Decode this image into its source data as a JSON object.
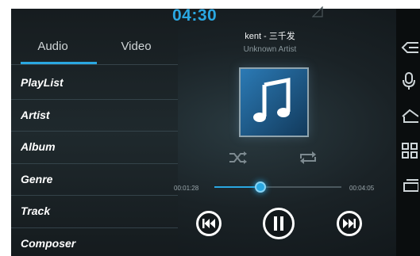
{
  "status": {
    "clock": "04:30"
  },
  "tabs": [
    {
      "label": "Audio",
      "active": true
    },
    {
      "label": "Video",
      "active": false
    }
  ],
  "menu": [
    {
      "label": "PlayList"
    },
    {
      "label": "Artist"
    },
    {
      "label": "Album"
    },
    {
      "label": "Genre"
    },
    {
      "label": "Track"
    },
    {
      "label": "Composer"
    }
  ],
  "now_playing": {
    "title": "kent - 三千发",
    "artist": "Unknown Artist",
    "elapsed": "00:01:28",
    "total": "00:04:05",
    "progress": 0.36
  },
  "icons": {
    "album_art": "music-note-icon",
    "shuffle": "shuffle-icon",
    "repeat": "repeat-icon",
    "prev": "skip-previous-icon",
    "play_pause": "pause-icon",
    "next": "skip-next-icon",
    "nav": [
      "back-icon",
      "microphone-icon",
      "home-icon",
      "apps-grid-icon",
      "recent-apps-icon"
    ]
  },
  "colors": {
    "accent": "#2aa7e1",
    "background": "#1a2226"
  }
}
